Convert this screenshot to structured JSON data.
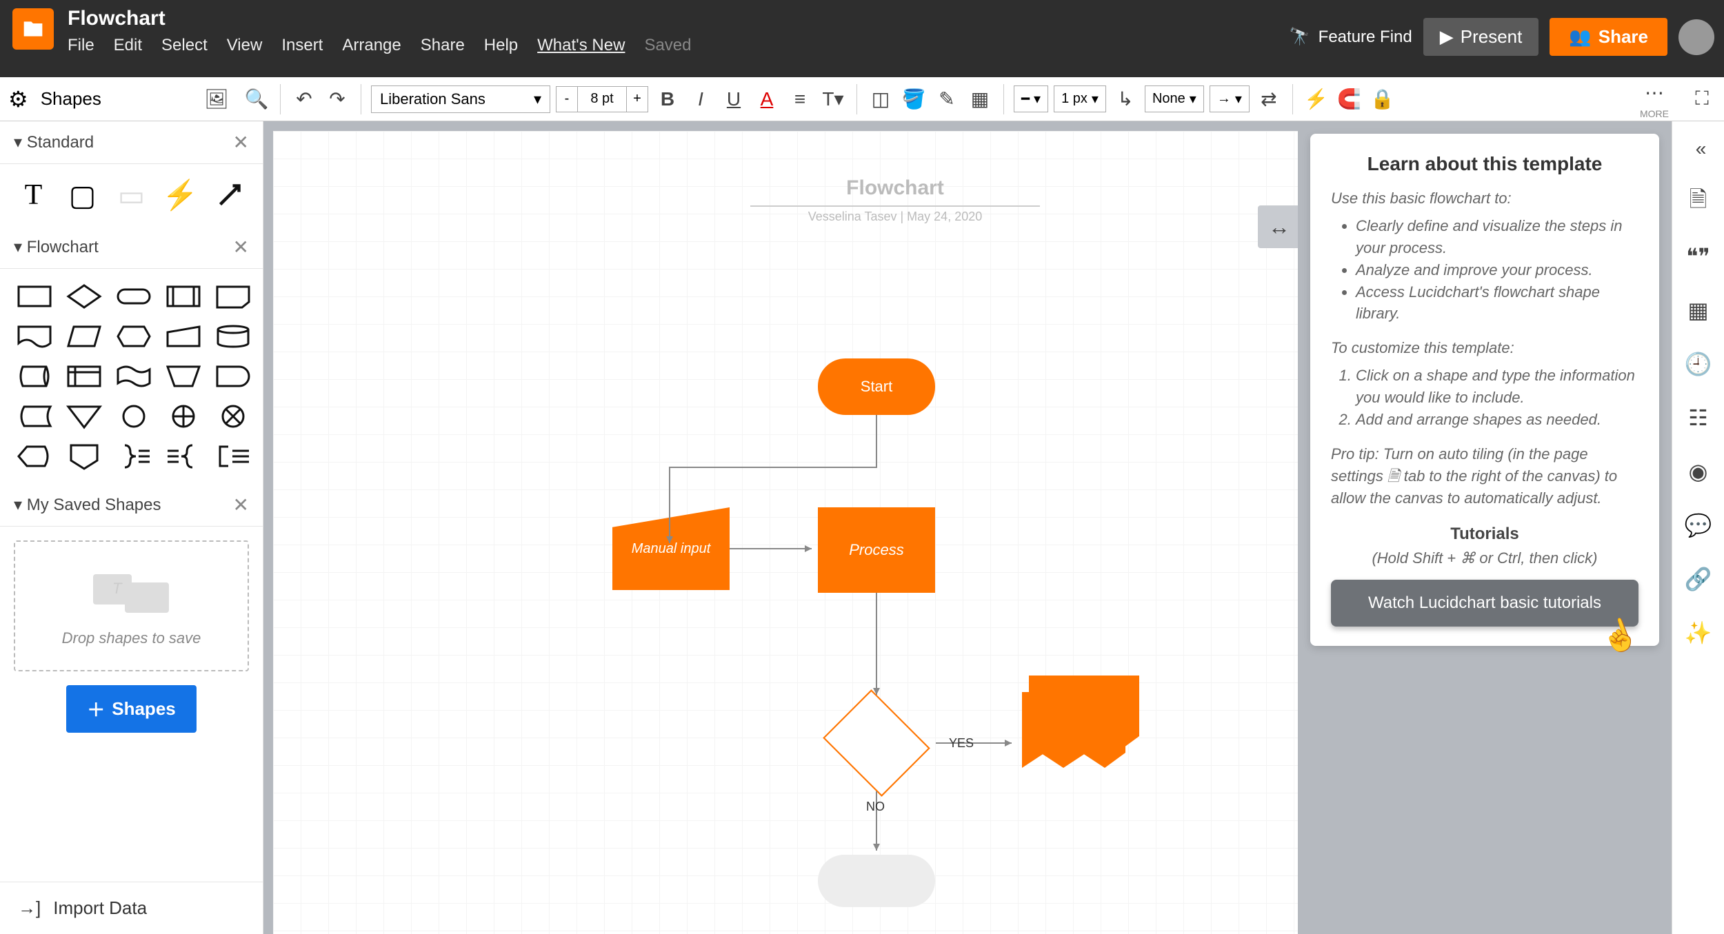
{
  "header": {
    "doc_title": "Flowchart",
    "menus": [
      "File",
      "Edit",
      "Select",
      "View",
      "Insert",
      "Arrange",
      "Share",
      "Help",
      "What's New",
      "Saved"
    ],
    "feature_find": "Feature Find",
    "present": "Present",
    "share": "Share"
  },
  "toolbar": {
    "shapes_label": "Shapes",
    "font": "Liberation Sans",
    "font_size": "8 pt",
    "stroke_width": "1 px",
    "line_end": "None",
    "more": "MORE"
  },
  "sidebar": {
    "standard_label": "Standard",
    "flowchart_label": "Flowchart",
    "saved_label": "My Saved Shapes",
    "drop_hint": "Drop shapes to save",
    "add_shapes": "Shapes",
    "import": "Import Data"
  },
  "canvas": {
    "title": "Flowchart",
    "byline": "Vesselina Tasev  |  May 24, 2020",
    "start": "Start",
    "manual": "Manual input",
    "process": "Process",
    "yes": "YES",
    "no": "NO"
  },
  "template": {
    "heading": "Learn about this template",
    "intro": "Use this basic flowchart to:",
    "bullets": [
      "Clearly define and visualize the steps in your process.",
      "Analyze and improve your process.",
      "Access Lucidchart's flowchart shape library."
    ],
    "customize_h": "To customize this template:",
    "steps": [
      "Click on a shape and type the information you would like to include.",
      "Add and arrange shapes as needed."
    ],
    "protip": "Pro tip: Turn on auto tiling (in the page settings 🗎 tab to the right of the canvas) to allow the canvas to automatically adjust.",
    "tutorials_h": "Tutorials",
    "tutorials_sub": "(Hold Shift + ⌘ or Ctrl, then click)",
    "tutorial_btn": "Watch Lucidchart basic tutorials"
  }
}
